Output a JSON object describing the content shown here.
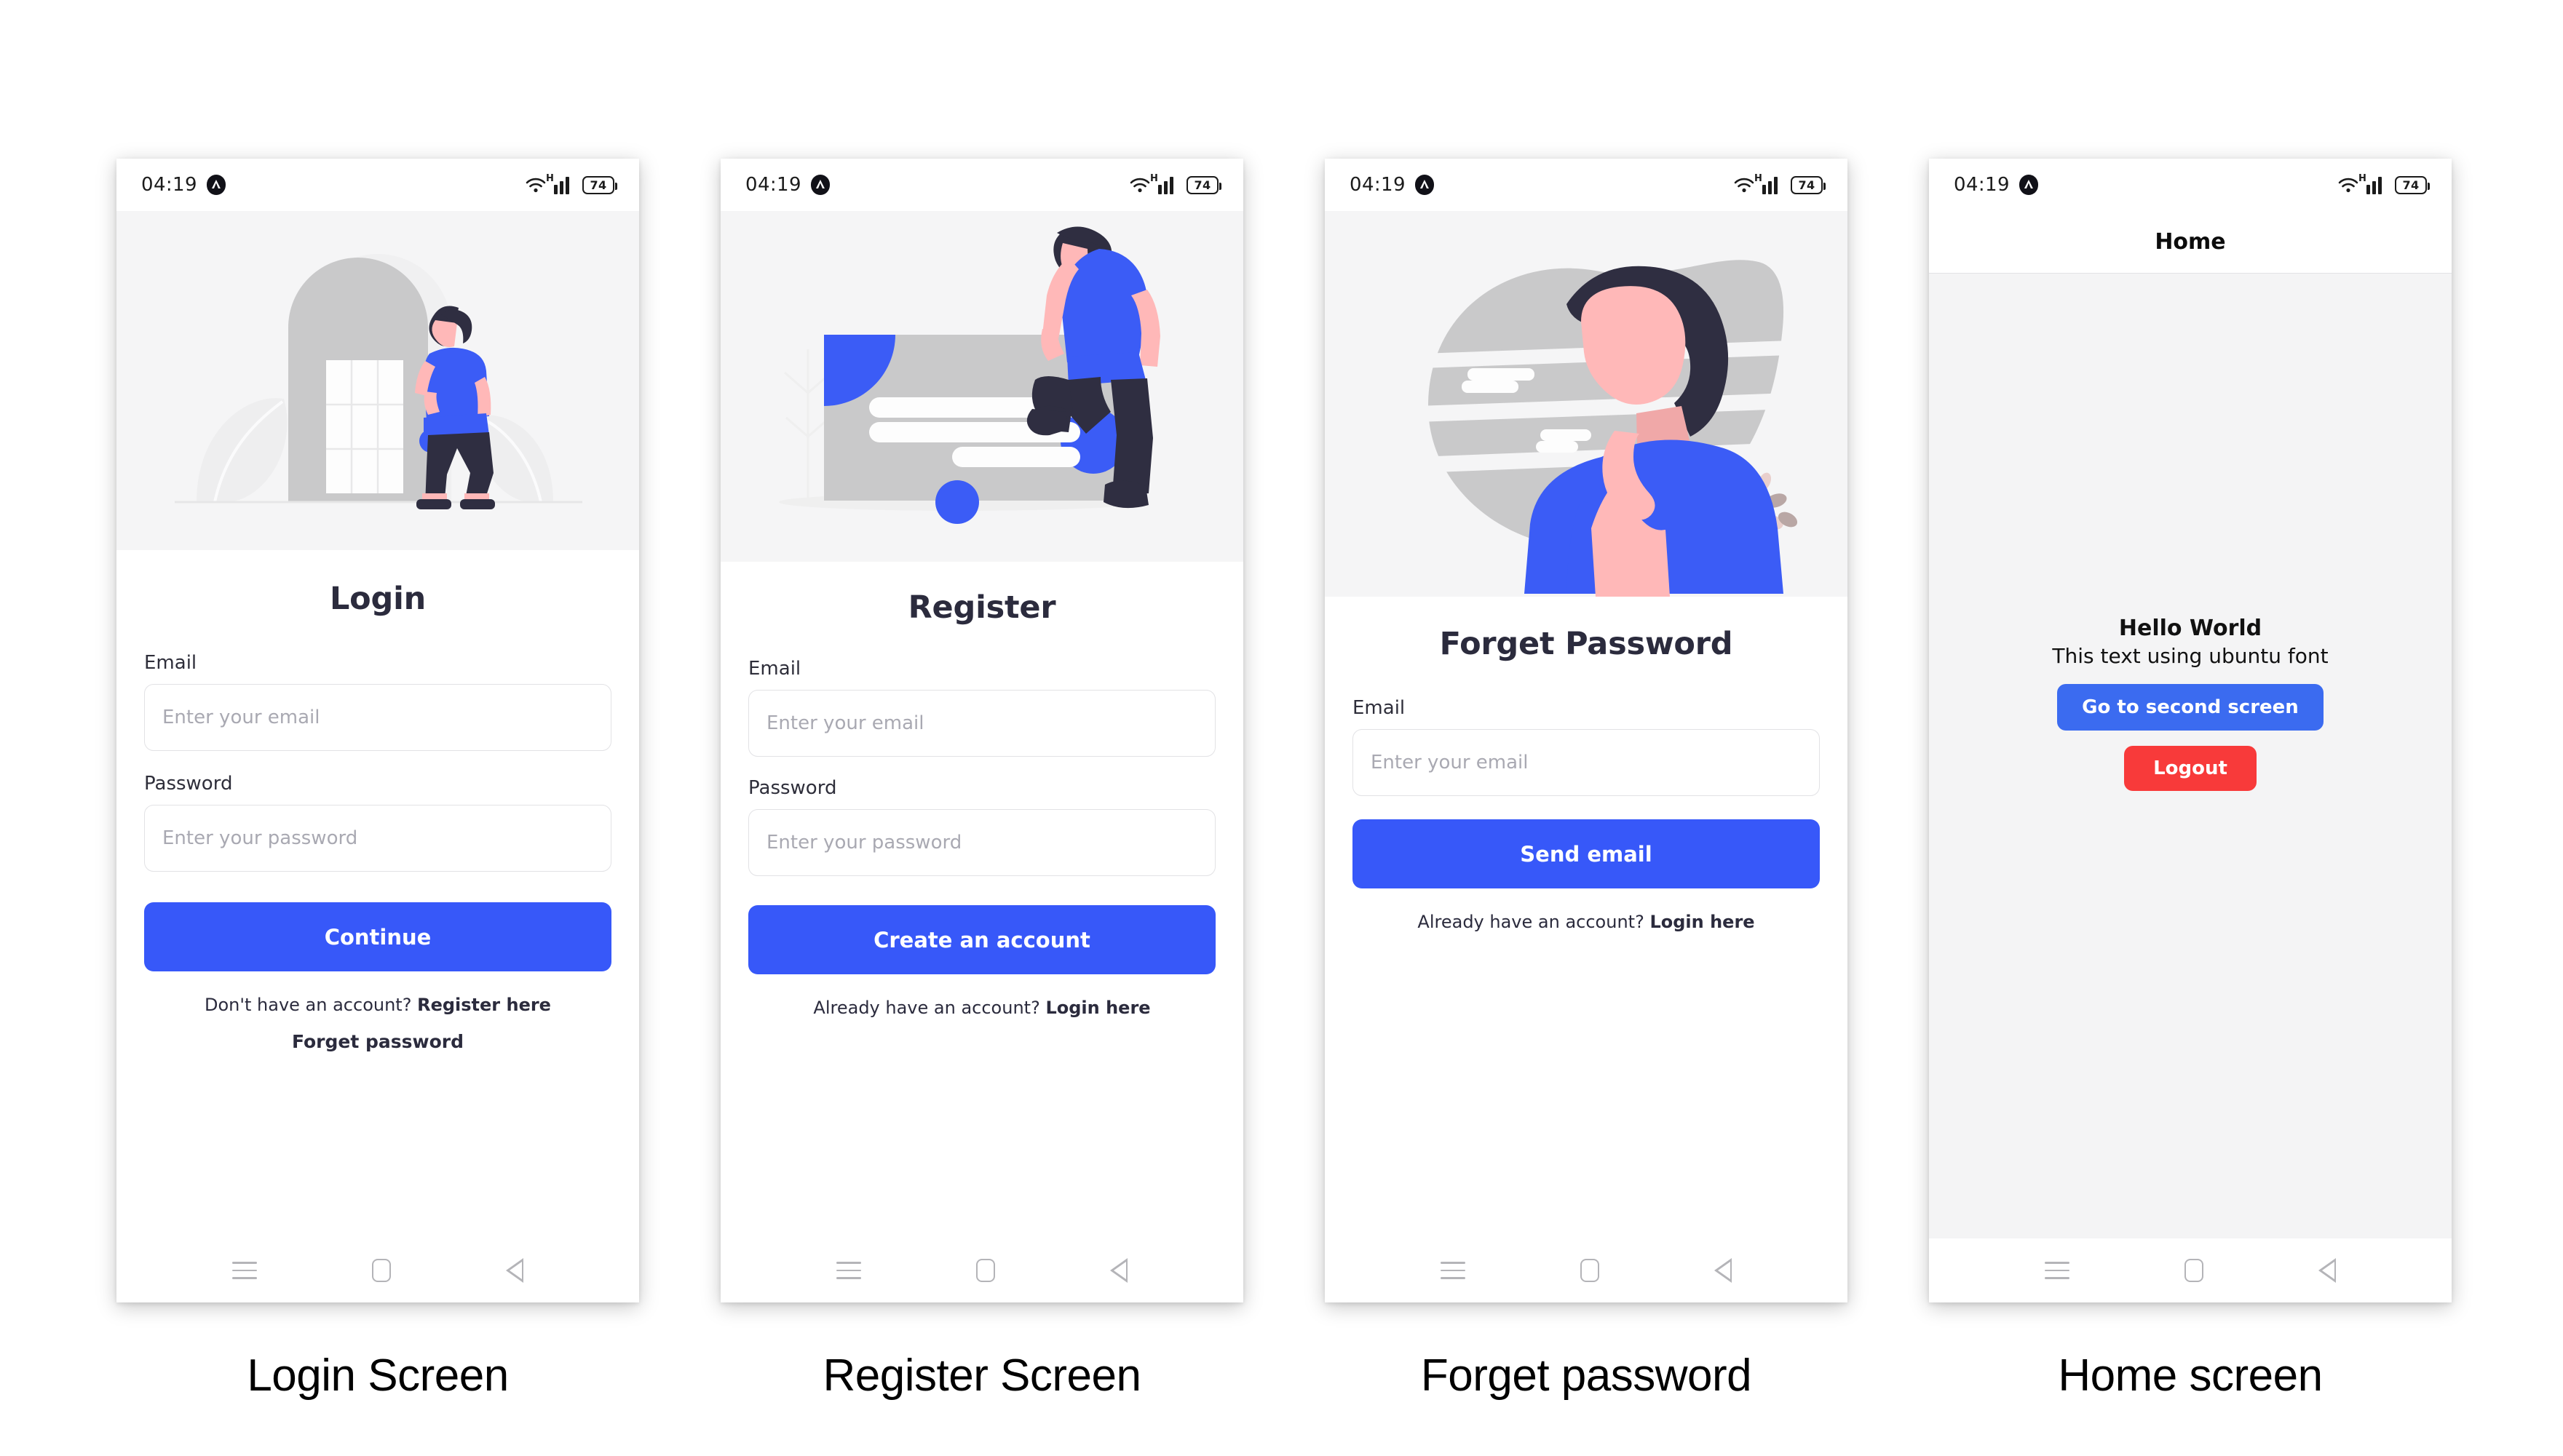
{
  "status_bar": {
    "time": "04:19",
    "battery": "74",
    "network_type": "H",
    "icons": [
      "app-badge-icon",
      "wifi-icon",
      "cellular-signal-icon",
      "battery-icon"
    ]
  },
  "nav_bar": {
    "recents_label": "Recents",
    "home_label": "Home",
    "back_label": "Back"
  },
  "colors": {
    "primary_blue": "#3758f9",
    "home_blue": "#3b6bf0",
    "logout_red": "#f83a3a",
    "illustration_bg": "#f5f5f6",
    "body_grey": "#f4f4f5",
    "text_dark": "#2b2b3d",
    "placeholder": "#a9a9b2",
    "border": "#e2e2e5"
  },
  "screens": [
    {
      "caption": "Login Screen",
      "title": "Login",
      "illustration": "door-man-illustration",
      "fields": [
        {
          "label": "Email",
          "placeholder": "Enter your email",
          "value": ""
        },
        {
          "label": "Password",
          "placeholder": "Enter your password",
          "value": ""
        }
      ],
      "primary_button": "Continue",
      "hint_text": "Don't have an account?",
      "hint_link": "Register here",
      "secondary_link": "Forget password"
    },
    {
      "caption": "Register Screen",
      "title": "Register",
      "illustration": "man-form-card-illustration",
      "fields": [
        {
          "label": "Email",
          "placeholder": "Enter your email",
          "value": ""
        },
        {
          "label": "Password",
          "placeholder": "Enter your password",
          "value": ""
        }
      ],
      "primary_button": "Create an account",
      "hint_text": "Already have an account?",
      "hint_link": "Login here"
    },
    {
      "caption": "Forget password",
      "title": "Forget Password",
      "illustration": "thinking-person-illustration",
      "fields": [
        {
          "label": "Email",
          "placeholder": "Enter your email",
          "value": ""
        }
      ],
      "primary_button": "Send email",
      "hint_text": "Already have an account?",
      "hint_link": "Login here"
    },
    {
      "caption": "Home screen",
      "appbar_title": "Home",
      "heading": "Hello World",
      "subtext": "This text using ubuntu font",
      "primary_button": "Go to second screen",
      "logout_button": "Logout"
    }
  ]
}
